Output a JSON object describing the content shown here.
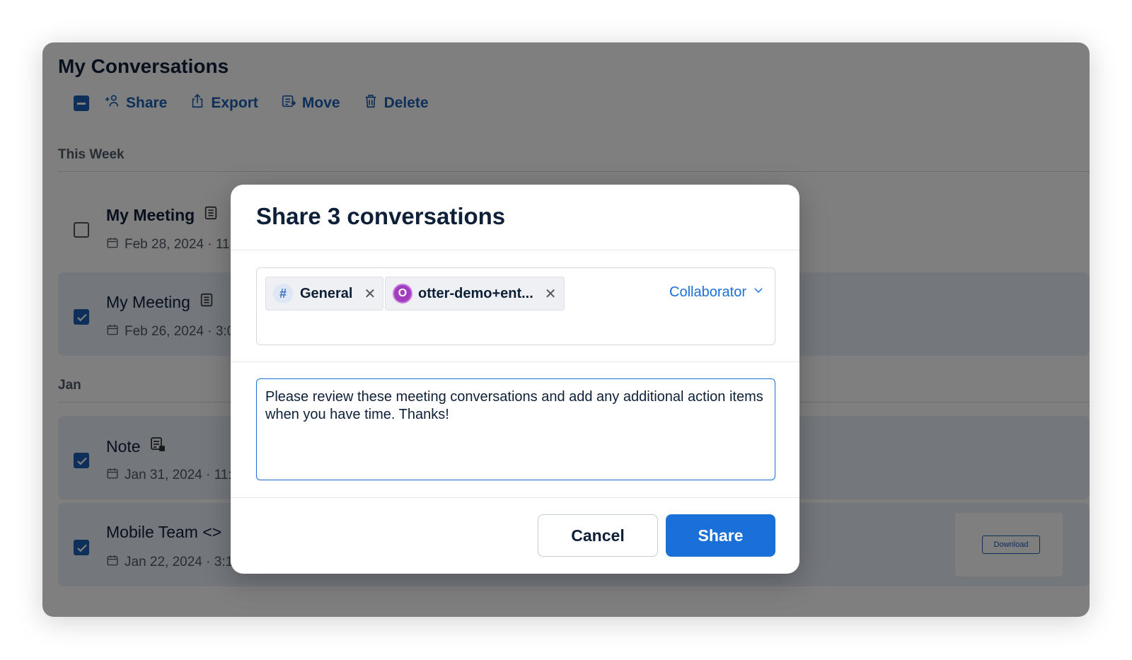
{
  "page": {
    "title": "My Conversations"
  },
  "toolbar": {
    "share_label": "Share",
    "export_label": "Export",
    "move_label": "Move",
    "delete_label": "Delete"
  },
  "sections": {
    "this_week": "This Week",
    "jan": "Jan"
  },
  "conversations": [
    {
      "title": "My Meeting",
      "date": "Feb 28, 2024 · 11:",
      "selected": false,
      "icon": "transcript-icon"
    },
    {
      "title": "My Meeting",
      "date": "Feb 26, 2024 · 3:0",
      "selected": true,
      "icon": "transcript-icon"
    },
    {
      "title": "Note",
      "date": "Jan 31, 2024 · 11:4",
      "selected": true,
      "icon": "note-icon"
    },
    {
      "title": "Mobile Team <>",
      "date": "Jan 22, 2024 · 3:1",
      "selected": true,
      "icon": ""
    }
  ],
  "download_label": "Download",
  "modal": {
    "title": "Share 3 conversations",
    "chips": [
      {
        "label": "General",
        "icon": "hash-icon"
      },
      {
        "label": "otter-demo+ent...",
        "avatar_letter": "O",
        "avatar_color": "#a23dbf"
      }
    ],
    "role": "Collaborator",
    "message": "Please review these meeting conversations and add any additional action items when you have time. Thanks!",
    "cancel_label": "Cancel",
    "share_label": "Share"
  },
  "colors": {
    "accent": "#1a6fd8",
    "selected_row": "#e8eef8",
    "text_dark": "#0e2038"
  }
}
